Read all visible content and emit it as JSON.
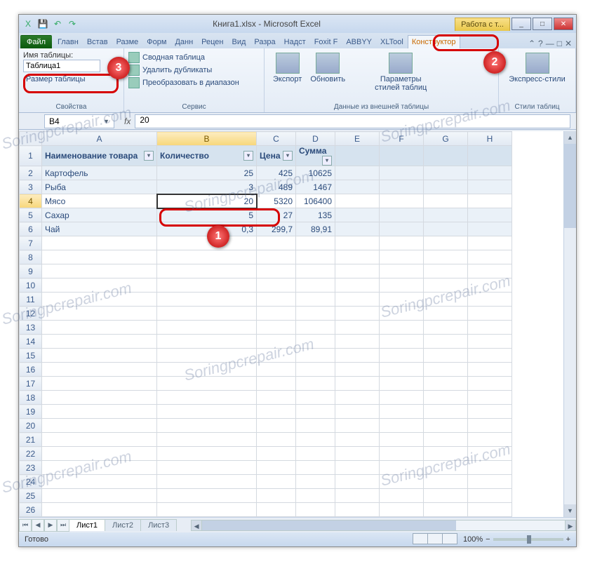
{
  "titlebar": {
    "title": "Книга1.xlsx - Microsoft Excel",
    "tooltab": "Работа с т...",
    "qat": {
      "excel": "X",
      "save": "💾",
      "undo": "↶",
      "redo": "↷"
    },
    "min": "_",
    "max": "□",
    "close": "✕"
  },
  "tabs": {
    "file": "Файл",
    "items": [
      "Главн",
      "Встав",
      "Разме",
      "Форм",
      "Данн",
      "Рецен",
      "Вид",
      "Разра",
      "Надст",
      "Foxit F",
      "ABBYY",
      "XLTool"
    ],
    "active": "Конструктор"
  },
  "ribbon": {
    "props": {
      "label": "Имя таблицы:",
      "value": "Таблица1",
      "resize": "Размер таблицы",
      "title": "Свойства"
    },
    "tools": {
      "pivot": "Сводная таблица",
      "dup": "Удалить дубликаты",
      "range": "Преобразовать в диапазон",
      "title": "Сервис"
    },
    "extern": {
      "export": "Экспорт",
      "refresh": "Обновить",
      "opts": "Параметры\nстилей таблиц",
      "title": "Данные из внешней таблицы"
    },
    "styles": {
      "quick": "Экспресс-стили",
      "title": "Стили таблиц"
    }
  },
  "fbar": {
    "name": "B4",
    "fx": "fx",
    "formula": "20"
  },
  "columns": [
    "A",
    "B",
    "C",
    "D",
    "E",
    "F",
    "G",
    "H"
  ],
  "rownums": [
    1,
    2,
    3,
    4,
    5,
    6,
    7,
    8,
    9,
    10,
    11,
    12,
    13,
    14,
    15,
    16,
    17,
    18,
    19,
    20,
    21,
    22,
    23,
    24,
    25,
    26
  ],
  "headers": [
    "Наименование товара",
    "Количество",
    "Цена",
    "Сумма"
  ],
  "rows": [
    {
      "a": "Картофель",
      "b": "25",
      "c": "425",
      "d": "10625"
    },
    {
      "a": "Рыба",
      "b": "3",
      "c": "489",
      "d": "1467"
    },
    {
      "a": "Мясо",
      "b": "20",
      "c": "5320",
      "d": "106400"
    },
    {
      "a": "Сахар",
      "b": "5",
      "c": "27",
      "d": "135"
    },
    {
      "a": "Чай",
      "b": "0,3",
      "c": "299,7",
      "d": "89,91"
    }
  ],
  "sheets": {
    "nav": [
      "⏮",
      "◀",
      "▶",
      "⏭"
    ],
    "s1": "Лист1",
    "s2": "Лист2",
    "s3": "Лист3"
  },
  "status": {
    "ready": "Готово",
    "zoom": "100%",
    "minus": "−",
    "plus": "+"
  },
  "badges": {
    "b1": "1",
    "b2": "2",
    "b3": "3"
  },
  "watermark": "Soringpcrepair.com"
}
